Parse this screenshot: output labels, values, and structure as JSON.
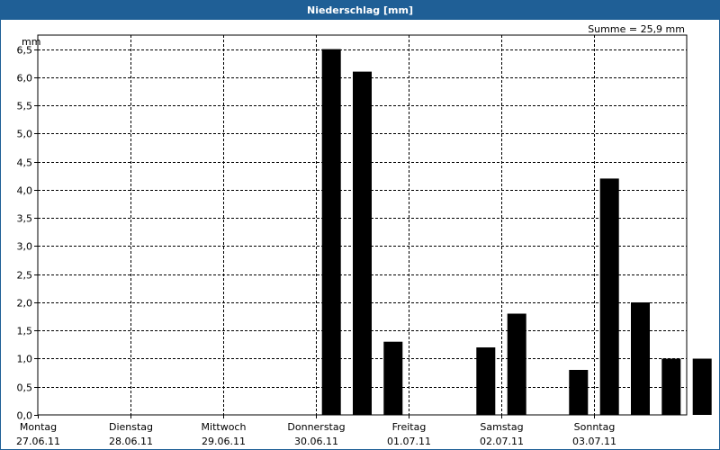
{
  "window": {
    "title": "Niederschlag [mm]"
  },
  "chart_data": {
    "type": "bar",
    "title": "Niederschlag [mm]",
    "annotation": "Summe = 25,9 mm",
    "ylabel": "mm",
    "ylim": [
      0,
      6.75
    ],
    "yticks": [
      "0,0",
      "0,5",
      "1,0",
      "1,5",
      "2,0",
      "2,5",
      "3,0",
      "3,5",
      "4,0",
      "4,5",
      "5,0",
      "5,5",
      "6,0",
      "6,5"
    ],
    "grid": true,
    "days": [
      {
        "name": "Montag",
        "date": "27.06.11"
      },
      {
        "name": "Dienstag",
        "date": "28.06.11"
      },
      {
        "name": "Mittwoch",
        "date": "29.06.11"
      },
      {
        "name": "Donnerstag",
        "date": "30.06.11"
      },
      {
        "name": "Freitag",
        "date": "01.07.11"
      },
      {
        "name": "Samstag",
        "date": "02.07.11"
      },
      {
        "name": "Sonntag",
        "date": "03.07.11"
      }
    ],
    "bars": [
      {
        "day": 3,
        "slot": 0,
        "value": 6.5
      },
      {
        "day": 3,
        "slot": 1,
        "value": 6.1
      },
      {
        "day": 3,
        "slot": 2,
        "value": 1.3
      },
      {
        "day": 4,
        "slot": 2,
        "value": 1.2
      },
      {
        "day": 5,
        "slot": 0,
        "value": 1.8
      },
      {
        "day": 5,
        "slot": 2,
        "value": 0.8
      },
      {
        "day": 6,
        "slot": 0,
        "value": 4.2
      },
      {
        "day": 6,
        "slot": 1,
        "value": 2.0
      },
      {
        "day": 6,
        "slot": 2,
        "value": 1.0
      },
      {
        "day": 6,
        "slot": 3,
        "value": 1.0
      }
    ],
    "bar_color": "#000000"
  }
}
